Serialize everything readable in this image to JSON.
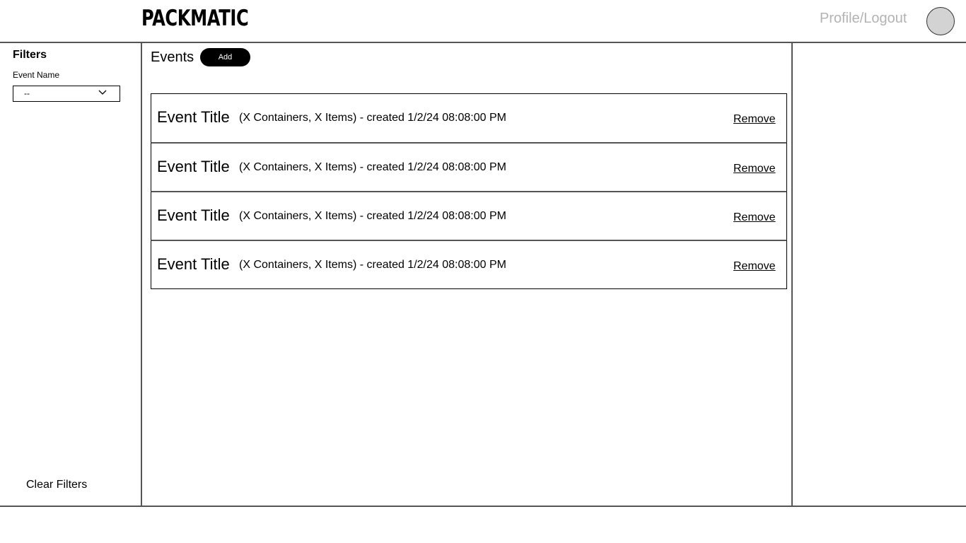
{
  "header": {
    "logo": "PACKMATIC",
    "profile_link": "Profile/Logout",
    "avatar_icon": "avatar-icon"
  },
  "sidebar": {
    "title": "Filters",
    "event_name_label": "Event Name",
    "event_name_select": {
      "selected": "--"
    },
    "clear_filters": "Clear Filters"
  },
  "main": {
    "title": "Events",
    "add_label": "Add",
    "events": [
      {
        "title": "Event Title",
        "meta": "(X Containers, X Items) - created 1/2/24 08:08:00 PM",
        "remove_label": "Remove"
      },
      {
        "title": "Event Title",
        "meta": "(X Containers, X Items) - created 1/2/24 08:08:00 PM",
        "remove_label": "Remove"
      },
      {
        "title": "Event Title",
        "meta": "(X Containers, X Items) - created 1/2/24 08:08:00 PM",
        "remove_label": "Remove"
      },
      {
        "title": "Event Title",
        "meta": "(X Containers, X Items) - created 1/2/24 08:08:00 PM",
        "remove_label": "Remove"
      }
    ]
  },
  "colors": {
    "accent": "#000000",
    "muted_text": "#b3b3b3",
    "avatar_fill": "#d3d3d3",
    "divider": "#555555"
  }
}
